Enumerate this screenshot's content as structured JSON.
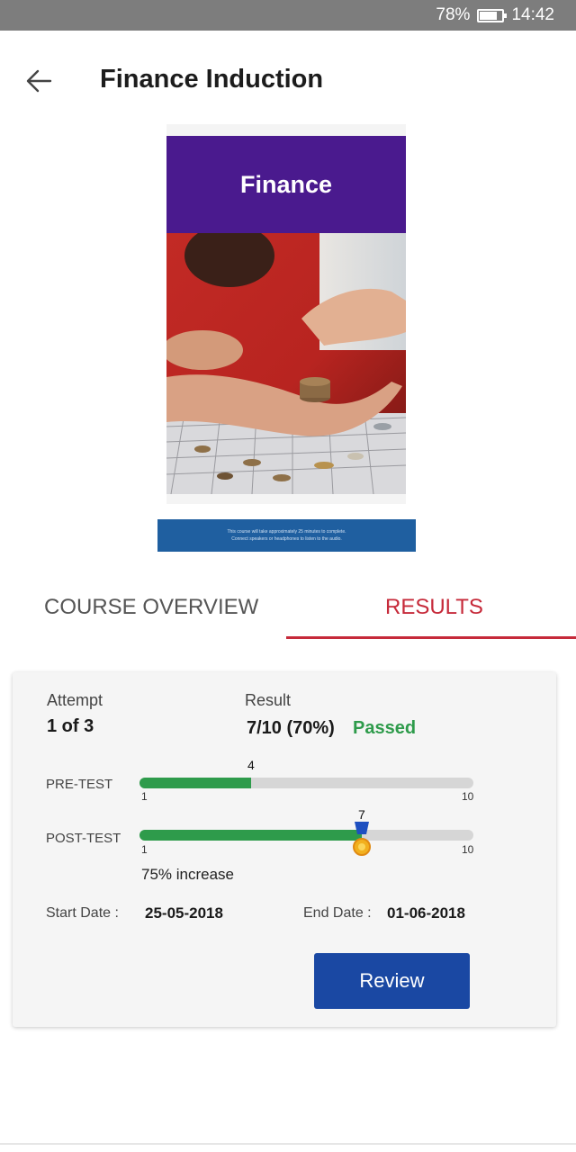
{
  "status_bar": {
    "battery": "78%",
    "time": "14:42"
  },
  "app_bar": {
    "title": "Finance Induction",
    "back_icon": "arrow-left-icon"
  },
  "course_cover": {
    "header_text": "Finance",
    "header_color": "#4a1a8e",
    "info_lines": [
      "This course will take approximately 25 minutes to complete.",
      "Connect speakers or headphones to listen to the audio."
    ]
  },
  "tabs": [
    {
      "label": "COURSE OVERVIEW",
      "selected": false
    },
    {
      "label": "RESULTS",
      "selected": true
    }
  ],
  "results": {
    "attempt_label": "Attempt",
    "attempt_value": "1 of 3",
    "result_label": "Result",
    "result_value": "7/10 (70%)",
    "result_status": "Passed",
    "pre_test": {
      "label": "PRE-TEST",
      "score": 4,
      "min": 1,
      "max": 10
    },
    "post_test": {
      "label": "POST-TEST",
      "score": 7,
      "min": 1,
      "max": 10
    },
    "increase_text": "75% increase",
    "start_date_label": "Start Date :",
    "start_date": "25-05-2018",
    "end_date_label": "End Date :",
    "end_date": "01-06-2018",
    "review_label": "Review"
  },
  "colors": {
    "accent_red": "#c62a3a",
    "pass_green": "#2e9b4b",
    "primary_blue": "#1a48a3"
  }
}
